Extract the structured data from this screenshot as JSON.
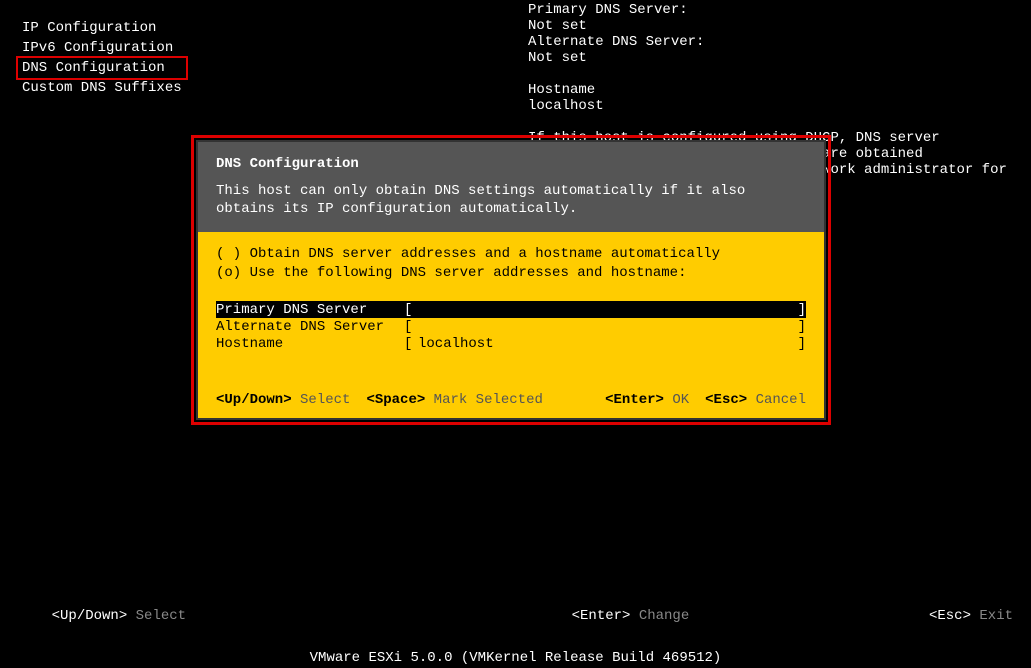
{
  "leftMenu": {
    "items": [
      {
        "label": "IP Configuration",
        "highlighted": false
      },
      {
        "label": "IPv6 Configuration",
        "highlighted": false
      },
      {
        "label": "DNS Configuration",
        "highlighted": true
      },
      {
        "label": "Custom DNS Suffixes",
        "highlighted": false
      }
    ]
  },
  "rightInfo": {
    "primaryLabel": "Primary DNS Server:",
    "primaryValue": "Not set",
    "alternateLabel": "Alternate DNS Server:",
    "alternateValue": "Not set",
    "hostnameLabel": "Hostname",
    "hostnameValue": "localhost",
    "helpText": "If this host is configured using DHCP, DNS server addresses and other DNS parameters are obtained automatically. If not, ask your network administrator for the appropriate settings."
  },
  "dialog": {
    "title": "DNS Configuration",
    "subtitle": "This host can only obtain DNS settings automatically if it also obtains its IP configuration automatically.",
    "radioAuto": "( ) Obtain DNS server addresses and a hostname automatically",
    "radioManual": "(o) Use the following DNS server addresses and hostname:",
    "fields": [
      {
        "label": "Primary DNS Server",
        "value": "",
        "selected": true
      },
      {
        "label": "Alternate DNS Server",
        "value": "",
        "selected": false
      },
      {
        "label": "Hostname",
        "value": "localhost",
        "selected": false
      }
    ],
    "footer": {
      "updownKey": "<Up/Down>",
      "updownAction": "Select",
      "spaceKey": "<Space>",
      "spaceAction": "Mark Selected",
      "enterKey": "<Enter>",
      "enterAction": "OK",
      "escKey": "<Esc>",
      "escAction": "Cancel"
    }
  },
  "bgFooter": {
    "updownKey": "<Up/Down>",
    "updownAction": "Select",
    "enterKey": "<Enter>",
    "enterAction": "Change",
    "escKey": "<Esc>",
    "escAction": "Exit"
  },
  "buildLine": "VMware ESXi 5.0.0 (VMKernel Release Build 469512)"
}
